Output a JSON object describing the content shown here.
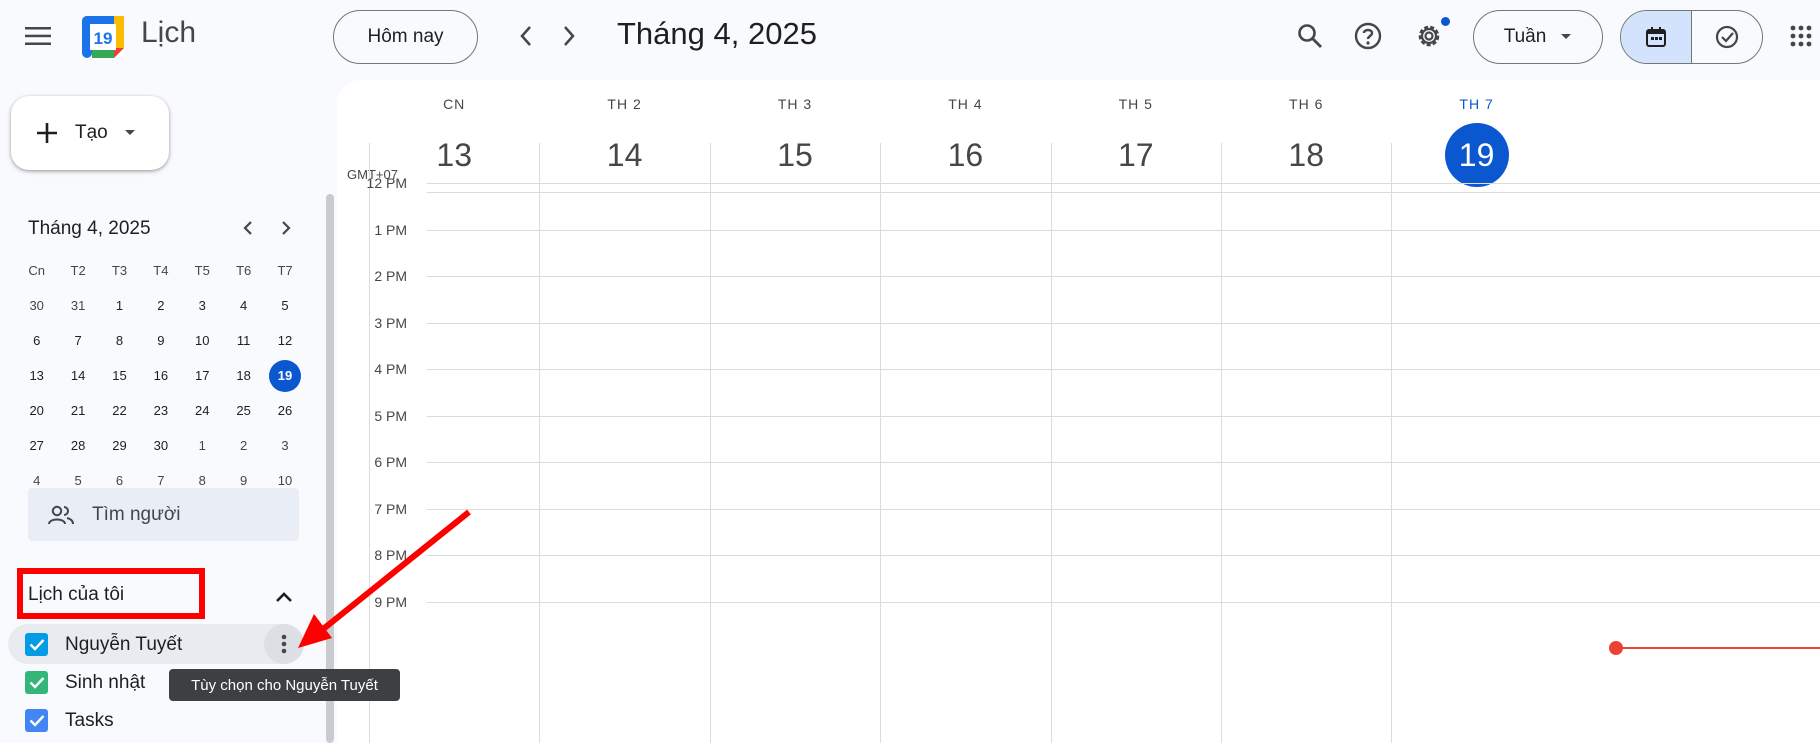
{
  "header": {
    "app_title": "Lịch",
    "logo_day": "19",
    "today_label": "Hôm nay",
    "period_title": "Tháng 4, 2025",
    "view_label": "Tuần"
  },
  "sidebar": {
    "create_label": "Tạo",
    "mini_calendar": {
      "title": "Tháng 4, 2025",
      "weekdays": [
        "Cn",
        "T2",
        "T3",
        "T4",
        "T5",
        "T6",
        "T7"
      ],
      "weeks": [
        [
          "30",
          "31",
          "1",
          "2",
          "3",
          "4",
          "5"
        ],
        [
          "6",
          "7",
          "8",
          "9",
          "10",
          "11",
          "12"
        ],
        [
          "13",
          "14",
          "15",
          "16",
          "17",
          "18",
          "19"
        ],
        [
          "20",
          "21",
          "22",
          "23",
          "24",
          "25",
          "26"
        ],
        [
          "27",
          "28",
          "29",
          "30",
          "1",
          "2",
          "3"
        ],
        [
          "4",
          "5",
          "6",
          "7",
          "8",
          "9",
          "10"
        ]
      ],
      "selected": "19"
    },
    "people_search_placeholder": "Tìm người",
    "my_calendars_title": "Lịch của tôi",
    "calendars": [
      {
        "name": "Nguyễn Tuyết",
        "color": "#039be5"
      },
      {
        "name": "Sinh nhật",
        "color": "#33b679"
      },
      {
        "name": "Tasks",
        "color": "#4285f4"
      }
    ],
    "tooltip": "Tùy chọn cho Nguyễn Tuyết"
  },
  "calendar": {
    "timezone": "GMT+07",
    "days": [
      {
        "dow": "CN",
        "num": "13"
      },
      {
        "dow": "TH 2",
        "num": "14"
      },
      {
        "dow": "TH 3",
        "num": "15"
      },
      {
        "dow": "TH 4",
        "num": "16"
      },
      {
        "dow": "TH 5",
        "num": "17"
      },
      {
        "dow": "TH 6",
        "num": "18"
      },
      {
        "dow": "TH 7",
        "num": "19"
      }
    ],
    "today_index": 6,
    "hours": [
      "12 PM",
      "1 PM",
      "2 PM",
      "3 PM",
      "4 PM",
      "5 PM",
      "6 PM",
      "7 PM",
      "8 PM",
      "9 PM"
    ]
  },
  "colors": {
    "accent": "#0b57d0",
    "now_line": "#ea4335",
    "annotation": "#ff0000"
  }
}
